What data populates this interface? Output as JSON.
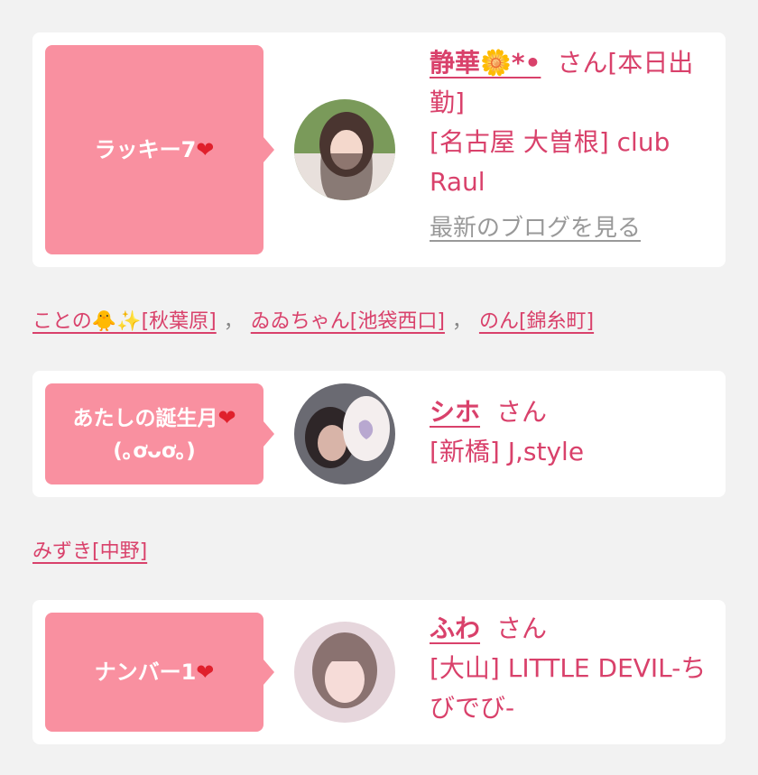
{
  "entries": [
    {
      "tag": "ラッキー7",
      "tag_icon": "❤",
      "name": "静華🌼*•",
      "honorific": "さん",
      "status": "[本日出勤]",
      "shop": "[名古屋 大曽根] club Raul",
      "blog_link": "最新のブログを見る"
    },
    {
      "tag": "あたしの誕生月",
      "tag_line2": "(｡ơᴗơ｡)",
      "tag_icon": "❤",
      "name": "シホ",
      "honorific": "さん",
      "shop": "[新橋] J,style"
    },
    {
      "tag": "ナンバー1",
      "tag_icon": "❤",
      "name": "ふわ",
      "honorific": "さん",
      "shop": "[大山] LITTLE DEVIL-ちびでび-"
    }
  ],
  "others_1": [
    "ことの🐥✨[秋葉原]",
    "ゐゐちゃん[池袋西口]",
    "のん[錦糸町]"
  ],
  "others_2": [
    "みずき[中野]"
  ],
  "separator": "，",
  "colors": {
    "accent": "#d9416b",
    "tag_bg": "#f990a0",
    "heart": "#e0202c",
    "bg": "#f2f2f2"
  }
}
